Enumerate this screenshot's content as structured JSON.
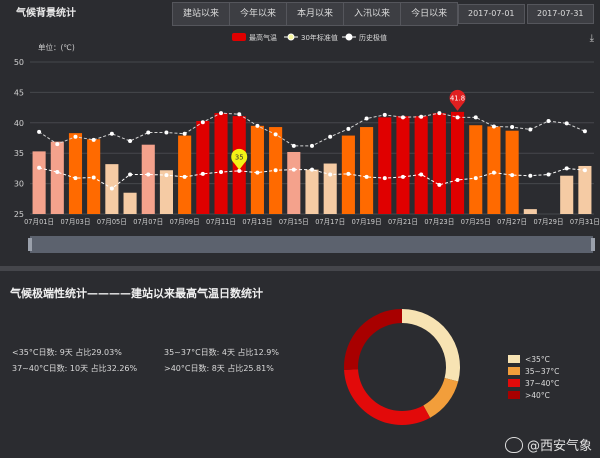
{
  "header": {
    "title": "气候背景统计",
    "tabs": [
      "建站以来",
      "今年以来",
      "本月以来",
      "入汛以来",
      "今日以来"
    ],
    "date_from": "2017-07-01",
    "date_to": "2017-07-31"
  },
  "chart_data": {
    "type": "bar",
    "unit_label": "单位：(℃)",
    "ylim": [
      25,
      50
    ],
    "yticks": [
      25,
      30,
      35,
      40,
      45,
      50
    ],
    "legend": [
      "最高气温",
      "30年标准值",
      "历史极值"
    ],
    "categories": [
      "07月01日",
      "07月02日",
      "07月03日",
      "07月04日",
      "07月05日",
      "07月06日",
      "07月07日",
      "07月08日",
      "07月09日",
      "07月10日",
      "07月11日",
      "07月12日",
      "07月13日",
      "07月14日",
      "07月15日",
      "07月16日",
      "07月17日",
      "07月18日",
      "07月19日",
      "07月20日",
      "07月21日",
      "07月22日",
      "07月23日",
      "07月24日",
      "07月25日",
      "07月26日",
      "07月27日",
      "07月28日",
      "07月29日",
      "07月30日",
      "07月31日"
    ],
    "xtick_labels": [
      "07月01日",
      "07月03日",
      "07月05日",
      "07月07日",
      "07月09日",
      "07月11日",
      "07月13日",
      "07月15日",
      "07月17日",
      "07月19日",
      "07月21日",
      "07月23日",
      "07月25日",
      "07月27日",
      "07月29日",
      "07月31日"
    ],
    "series": [
      {
        "name": "最高气温",
        "values": [
          35.3,
          36.9,
          38.3,
          37.3,
          33.2,
          28.5,
          36.4,
          32.2,
          37.9,
          40.3,
          41.6,
          41.1,
          39.5,
          39.3,
          35.2,
          32.3,
          33.3,
          37.9,
          39.3,
          40.9,
          41.1,
          41.1,
          41.6,
          41.8,
          39.6,
          39.4,
          38.7,
          25.8,
          25,
          31.3,
          32.9
        ]
      },
      {
        "name": "30年标准值",
        "values": [
          32.6,
          31.9,
          30.9,
          31.0,
          29.2,
          31.5,
          31.5,
          31.4,
          31.1,
          31.6,
          31.9,
          32.1,
          31.8,
          32.2,
          32.3,
          32.3,
          31.5,
          31.6,
          31.1,
          30.9,
          31.1,
          31.5,
          29.8,
          30.6,
          30.9,
          31.8,
          31.4,
          31.3,
          31.5,
          32.5,
          32.2
        ]
      },
      {
        "name": "历史极值",
        "values": [
          38.5,
          36.5,
          37.7,
          37.2,
          38.2,
          37.0,
          38.4,
          38.4,
          38.2,
          40.1,
          41.6,
          41.4,
          39.5,
          38.1,
          36.2,
          36.2,
          37.7,
          39.0,
          40.7,
          41.3,
          40.9,
          41.0,
          41.6,
          40.9,
          40.9,
          39.4,
          39.3,
          38.9,
          40.3,
          39.9,
          38.6
        ]
      }
    ],
    "markers": [
      {
        "label": "35",
        "index": 11,
        "series": "30年标准值"
      },
      {
        "label": "41.8",
        "index": 23,
        "series": "最高气温"
      }
    ],
    "colors": {
      "below35": "#f5cba4",
      "b35_37": "#f4a28c",
      "b37_40": "#ff6a00",
      "above40": "#e00000",
      "normal_line": "#ffffff",
      "record_line": "#d4d4d4"
    }
  },
  "bottom": {
    "title": "气候极端性统计————建站以来最高气温日数统计",
    "stats": [
      "<35°C日数: 9天 占比29.03%",
      "35~37°C日数: 4天 占比12.9%",
      "37~40°C日数: 10天 占比32.26%",
      ">40°C日数: 8天 占比25.81%"
    ],
    "pie": {
      "type": "pie",
      "categories": [
        "<35°C",
        "35~37°C",
        "37~40°C",
        ">40°C"
      ],
      "values": [
        9,
        4,
        10,
        8
      ],
      "colors": [
        "#f7e3b3",
        "#f29e3b",
        "#e20a0a",
        "#a80000"
      ]
    }
  },
  "watermark": "@西安气象"
}
